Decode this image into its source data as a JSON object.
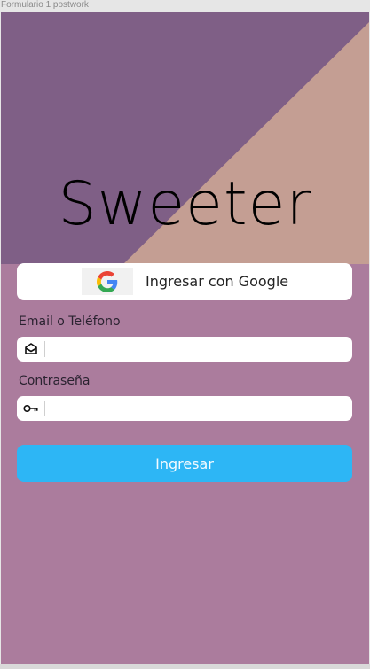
{
  "frame": {
    "label": "Formulario 1 postwork"
  },
  "brand": {
    "title": "Sweeter"
  },
  "google": {
    "label": "Ingresar con Google",
    "icon": "google-g-icon"
  },
  "email": {
    "label": "Email o Teléfono",
    "value": "",
    "placeholder": "",
    "icon": "mail-icon"
  },
  "password": {
    "label": "Contraseña",
    "value": "",
    "placeholder": "",
    "icon": "key-icon"
  },
  "submit": {
    "label": "Ingresar"
  },
  "colors": {
    "background": "#ab7c9d",
    "top_left": "#7f5f86",
    "top_right": "#c49e93",
    "primary_button": "#2db6f5"
  }
}
